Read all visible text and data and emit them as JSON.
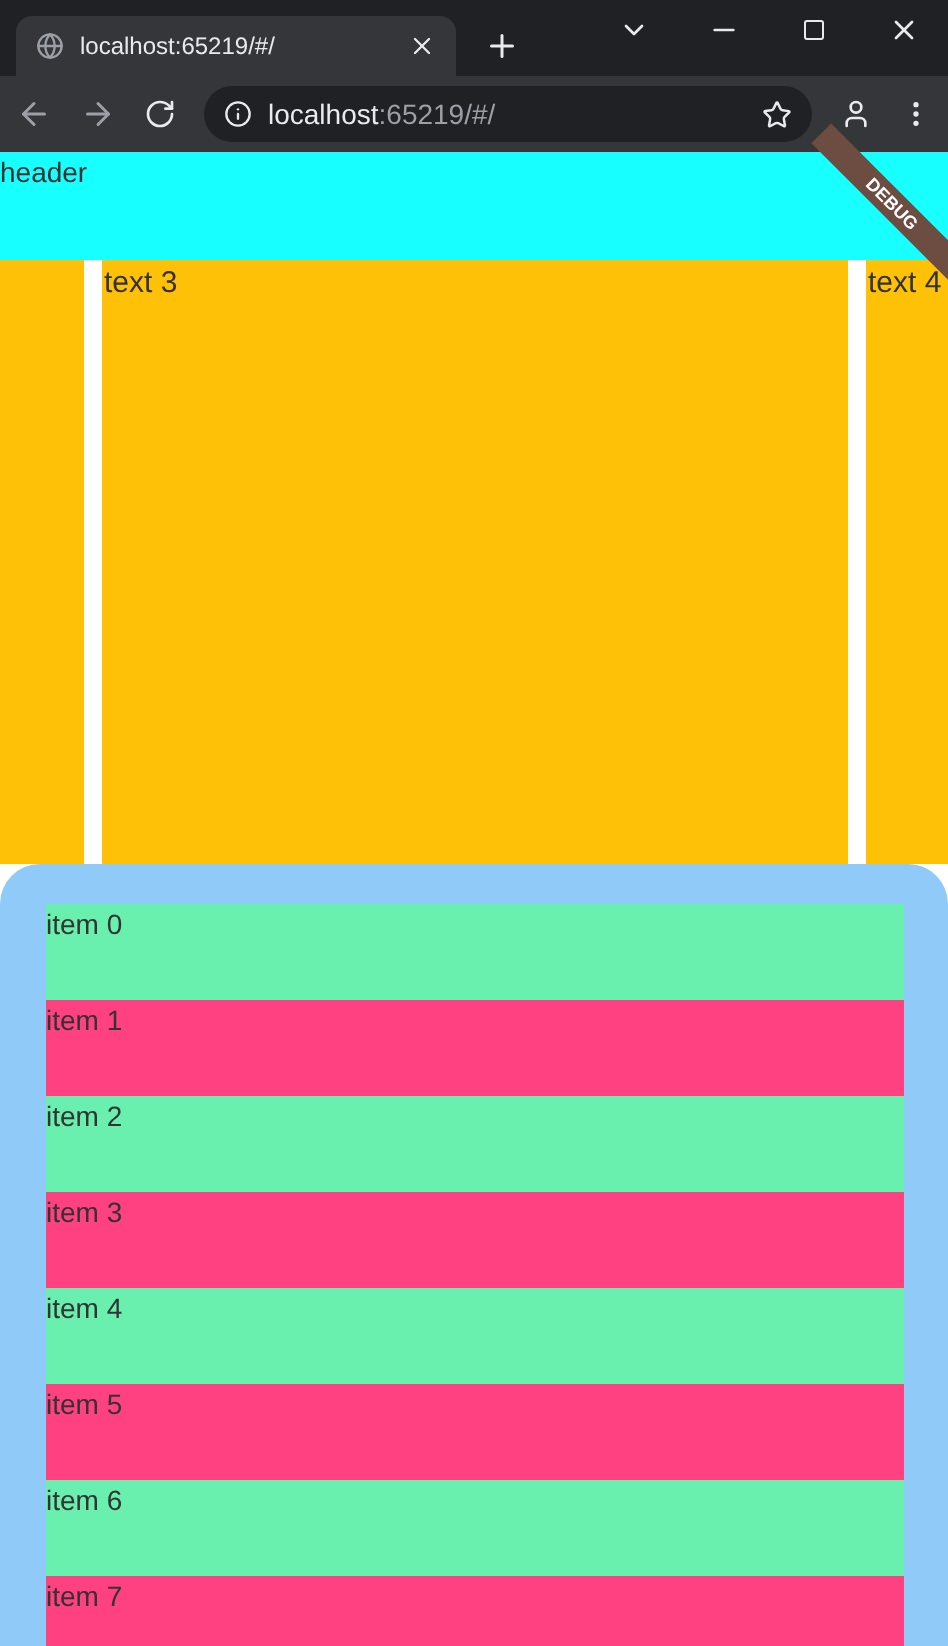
{
  "browser": {
    "tab_title": "localhost:65219/#/",
    "url_host": "localhost",
    "url_rest": ":65219/#/"
  },
  "header": {
    "text": "header"
  },
  "debug_banner": "DEBUG",
  "pages": [
    {
      "kind": "blank"
    },
    {
      "kind": "text",
      "text": "text 3"
    },
    {
      "kind": "text",
      "text": "text 4"
    }
  ],
  "items": [
    {
      "label": "item 0",
      "color": "#69f0ae"
    },
    {
      "label": "item 1",
      "color": "#ff4081"
    },
    {
      "label": "item 2",
      "color": "#69f0ae"
    },
    {
      "label": "item 3",
      "color": "#ff4081"
    },
    {
      "label": "item 4",
      "color": "#69f0ae"
    },
    {
      "label": "item 5",
      "color": "#ff4081"
    },
    {
      "label": "item 6",
      "color": "#69f0ae"
    },
    {
      "label": "item 7",
      "color": "#ff4081"
    }
  ]
}
